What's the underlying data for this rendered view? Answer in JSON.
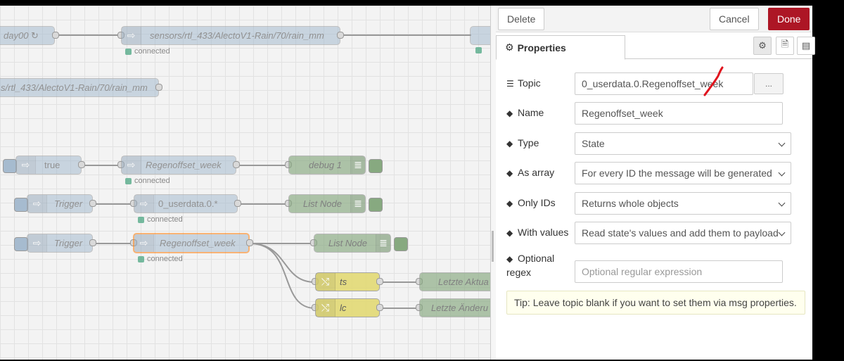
{
  "workspace": {
    "nodes": {
      "n1": "day00 ↻",
      "n2": "sensors/rtl_433/AlectoV1-Rain/70/rain_mm",
      "n3": "s/rtl_433/AlectoV1-Rain/70/rain_mm",
      "n4": "true",
      "n5": "Regenoffset_week",
      "n6": "debug 1",
      "n7": "Trigger",
      "n8": "0_userdata.0.*",
      "n9": "List Node",
      "n10": "Trigger",
      "n11": "Regenoffset_week",
      "n12": "List Node",
      "n13": "ts",
      "n14": "Letzte Aktua",
      "n15": "lc",
      "n16": "Letzte Änderu"
    },
    "status_connected": "connected"
  },
  "tray": {
    "delete_label": "Delete",
    "cancel_label": "Cancel",
    "done_label": "Done",
    "tab_properties": "Properties",
    "icons": {
      "tab_settings": "gear-icon",
      "tab_description": "document-icon",
      "tab_appearance": "layout-icon"
    },
    "form": {
      "topic_label": "Topic",
      "topic_value": "0_userdata.0.Regenoffset_week",
      "topic_button": "...",
      "name_label": "Name",
      "name_value": "Regenoffset_week",
      "type_label": "Type",
      "type_value": "State",
      "as_array_label": "As array",
      "as_array_value": "For every ID the message will be generated",
      "only_ids_label": "Only IDs",
      "only_ids_value": "Returns whole objects",
      "with_values_label": "With values",
      "with_values_value": "Read state's values and add them to payload",
      "regex_label_1": "Optional",
      "regex_label_2": "regex",
      "regex_placeholder": "Optional regular expression"
    },
    "tip": "Tip: Leave topic blank if you want to set them via msg properties."
  },
  "colors": {
    "done": "#ad1625",
    "selected_border": "#ff7f0e",
    "annotation": "#e0141e"
  }
}
